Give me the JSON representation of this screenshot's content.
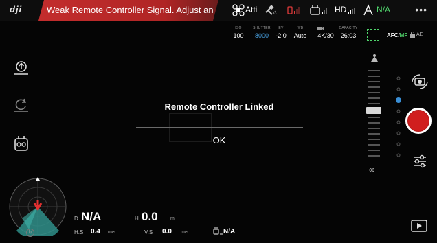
{
  "topbar": {
    "logo": "dji",
    "alert": "Weak Remote Controller Signal. Adjust an",
    "flight_mode": "Atti",
    "video_link": "HD",
    "battery": "N/A",
    "more_icon": "more-dots-icon"
  },
  "camera": {
    "iso_label": "ISO",
    "iso": "100",
    "shutter_label": "SHUTTER",
    "shutter": "8000",
    "ev_label": "EV",
    "ev": "-2.0",
    "wb_label": "WB",
    "wb": "Auto",
    "video_label": "",
    "video": "4K/30",
    "capacity_label": "CAPACITY",
    "capacity": "26:03",
    "focus_mode_a": "AFC/",
    "focus_mode_b": "MF",
    "ae_lock": "AE"
  },
  "dialog": {
    "title": "Remote Controller Linked",
    "ok": "OK"
  },
  "telemetry": {
    "d_label": "D",
    "d_value": "N/A",
    "h_label": "H",
    "h_value": "0.0",
    "h_unit": "m",
    "hs_label": "H.S",
    "hs_value": "0.4",
    "hs_unit": "m/s",
    "vs_label": "V.S",
    "vs_value": "0.0",
    "vs_unit": "m/s",
    "rc_distance": "N/A"
  },
  "colors": {
    "alert_red": "#c32d2d",
    "accent_green": "#4fd36b",
    "accent_blue": "#4aa6e8",
    "record_red": "#d01e1e"
  }
}
